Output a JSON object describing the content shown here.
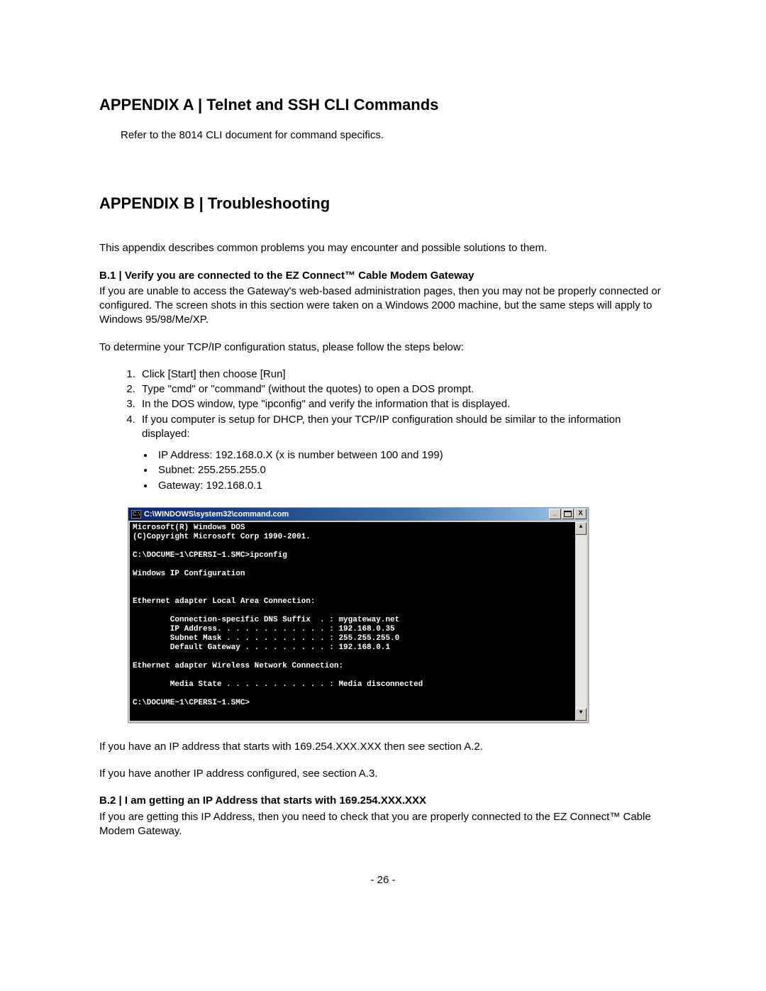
{
  "appendixA": {
    "heading": "APPENDIX A | Telnet and SSH CLI Commands",
    "line": "Refer to the 8014 CLI document for command specifics."
  },
  "appendixB": {
    "heading": "APPENDIX B | Troubleshooting",
    "intro": "This appendix describes common problems you may encounter and possible solutions to them.",
    "b1_title": "B.1 | Verify you are connected to the EZ Connect™ Cable Modem Gateway",
    "b1_para": "If you are unable to access the Gateway's web-based administration pages, then you may not be properly connected or configured. The screen shots in this section were taken on a Windows 2000 machine, but the same steps will apply to Windows 95/98/Me/XP.",
    "b1_lead": "To determine your TCP/IP configuration status, please follow the steps below:",
    "steps": [
      "Click [Start] then choose [Run]",
      "Type \"cmd\" or \"command\" (without the quotes) to open a DOS prompt.",
      "In the DOS window, type \"ipconfig\" and verify the information that is displayed.",
      "If you computer is setup for DHCP, then your TCP/IP configuration should be similar to the information displayed:"
    ],
    "bullets": [
      "IP Address: 192.168.0.X (x is number between 100 and 199)",
      "Subnet: 255.255.255.0",
      "Gateway: 192.168.0.1"
    ],
    "after1": "If you have an IP address that starts with 169.254.XXX.XXX then see section A.2.",
    "after2": "If you have another IP address configured, see section A.3.",
    "b2_title": "B.2 | I am getting an IP Address that starts with 169.254.XXX.XXX",
    "b2_para": "If you are getting this IP Address, then you need to check that you are properly connected to the EZ Connect™ Cable Modem Gateway."
  },
  "cmd": {
    "title": "C:\\WINDOWS\\system32\\command.com",
    "icon_text": "C:\\",
    "min": "_",
    "close": "X",
    "up": "▲",
    "down": "▼",
    "body": "Microsoft(R) Windows DOS\n(C)Copyright Microsoft Corp 1990-2001.\n\nC:\\DOCUME~1\\CPERSI~1.SMC>ipconfig\n\nWindows IP Configuration\n\n\nEthernet adapter Local Area Connection:\n\n        Connection-specific DNS Suffix  . : mygateway.net\n        IP Address. . . . . . . . . . . . : 192.168.0.35\n        Subnet Mask . . . . . . . . . . . : 255.255.255.0\n        Default Gateway . . . . . . . . . : 192.168.0.1\n\nEthernet adapter Wireless Network Connection:\n\n        Media State . . . . . . . . . . . : Media disconnected\n\nC:\\DOCUME~1\\CPERSI~1.SMC>"
  },
  "page_number": "- 26 -"
}
